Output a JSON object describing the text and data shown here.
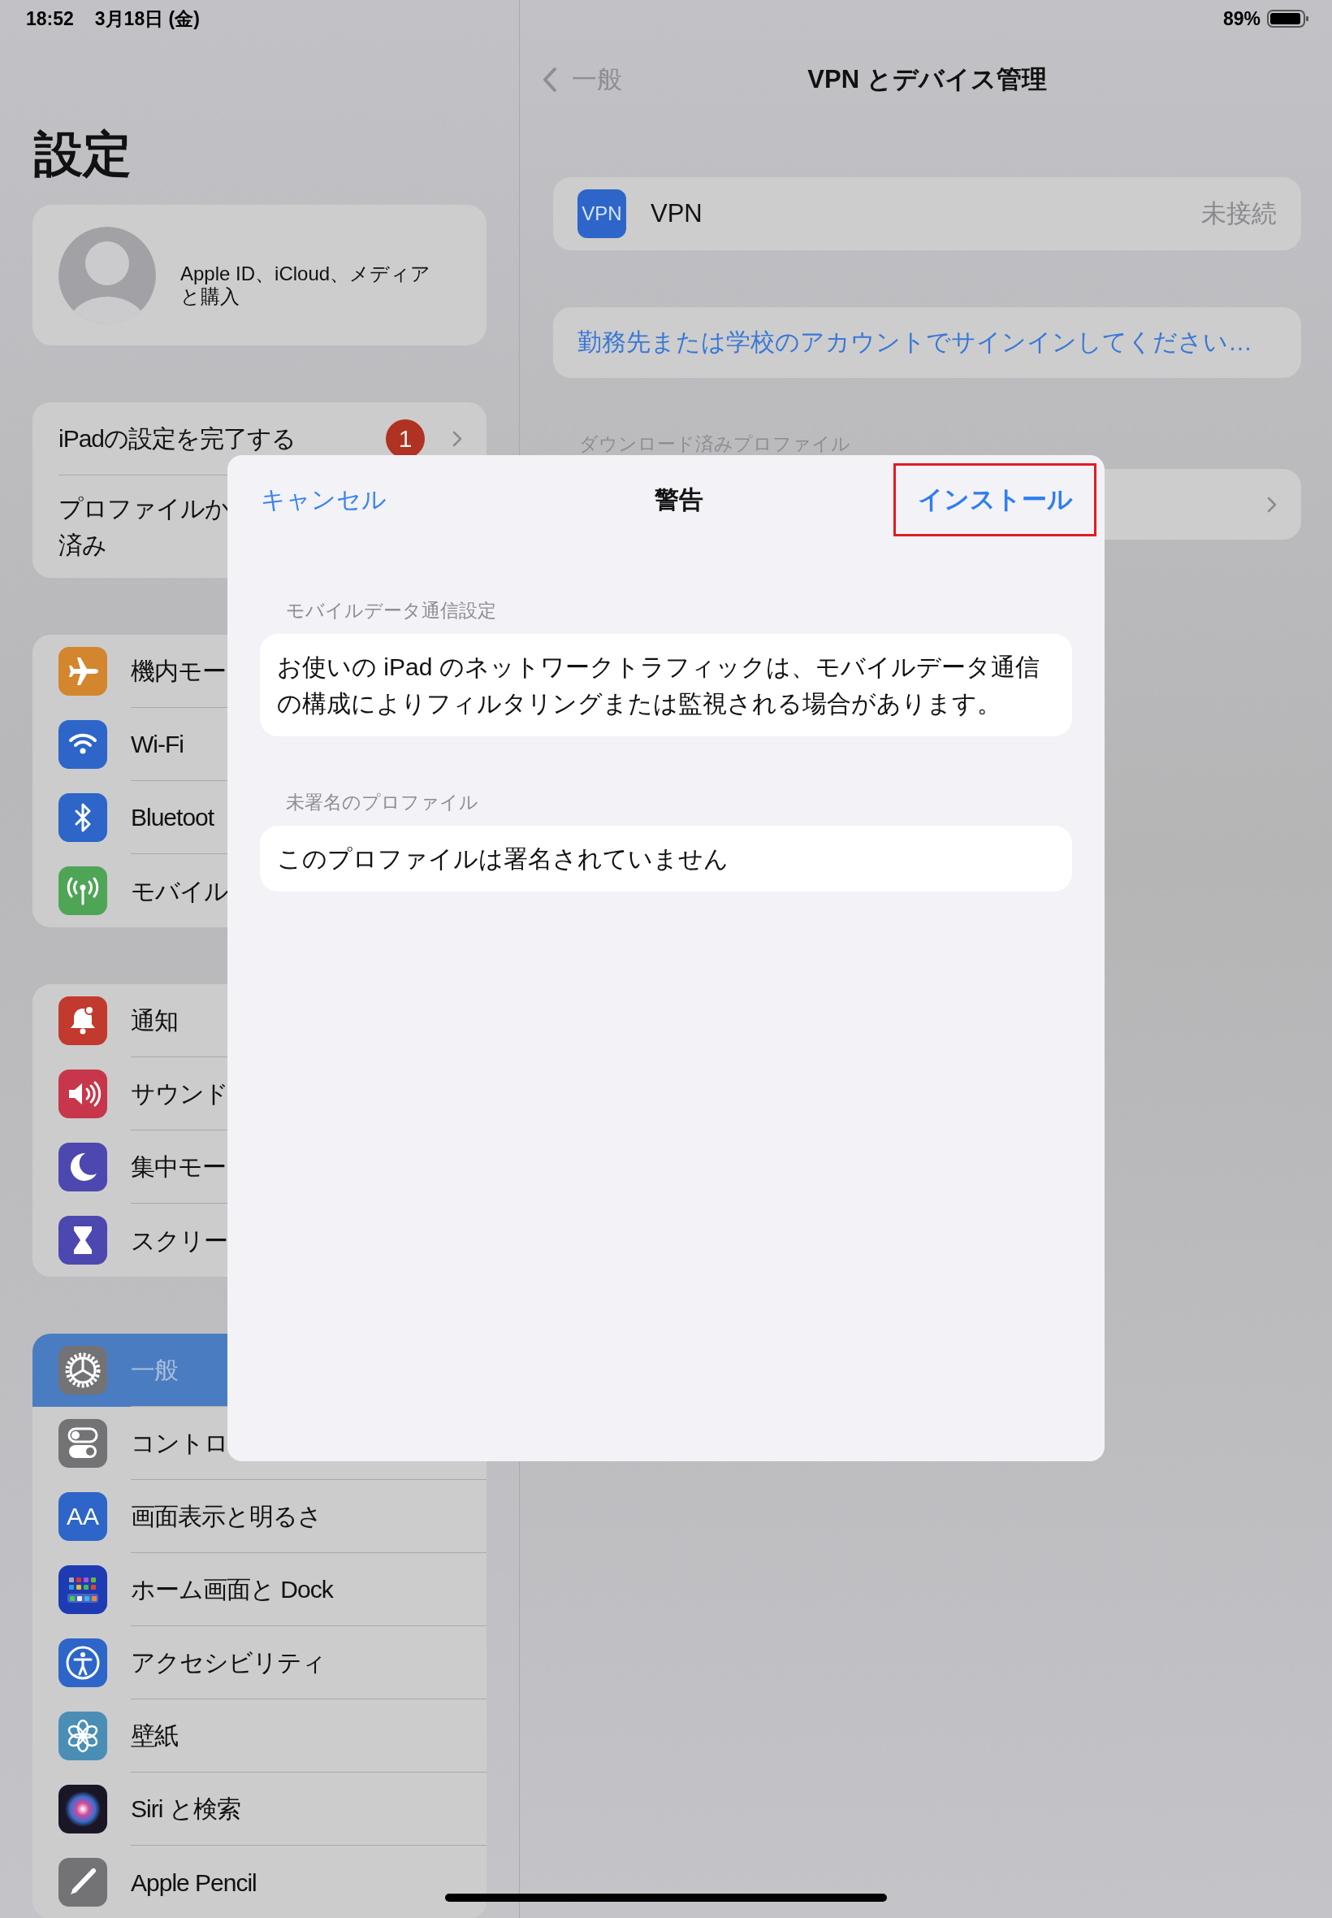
{
  "status_bar": {
    "time": "18:52",
    "date": "3月18日 (金)",
    "battery": "89%"
  },
  "sidebar": {
    "title": "設定",
    "account": {
      "text": "Apple ID、iCloud、メディアと購入"
    },
    "groups": [
      {
        "items": [
          {
            "lines": [
              "iPadの設定を完了する"
            ],
            "badge": "1",
            "chevron": true,
            "selected": false
          },
          {
            "lines": [
              "プロファイルか",
              "済み"
            ],
            "selected": false
          }
        ]
      },
      {
        "items": [
          {
            "lines": [
              "機内モー"
            ],
            "selected": false
          },
          {
            "lines": [
              "Wi-Fi"
            ],
            "selected": false
          },
          {
            "lines": [
              "Bluetoot"
            ],
            "selected": false
          },
          {
            "lines": [
              "モバイル"
            ],
            "selected": false
          }
        ]
      },
      {
        "items": [
          {
            "lines": [
              "通知"
            ],
            "selected": false
          },
          {
            "lines": [
              "サウンド"
            ],
            "selected": false
          },
          {
            "lines": [
              "集中モー"
            ],
            "selected": false
          },
          {
            "lines": [
              "スクリー"
            ],
            "selected": false
          }
        ]
      },
      {
        "items": [
          {
            "lines": [
              "一般"
            ],
            "selected": true
          },
          {
            "lines": [
              "コントロ"
            ],
            "selected": false
          },
          {
            "lines": [
              "画面表示と明るさ"
            ],
            "icon_text": "AA",
            "selected": false
          },
          {
            "lines": [
              "ホーム画面と Dock"
            ],
            "selected": false
          },
          {
            "lines": [
              "アクセシビリティ"
            ],
            "selected": false
          },
          {
            "lines": [
              "壁紙"
            ],
            "selected": false
          },
          {
            "lines": [
              "Siri と検索"
            ],
            "selected": false
          },
          {
            "lines": [
              "Apple Pencil"
            ],
            "selected": false
          }
        ]
      }
    ]
  },
  "detail": {
    "nav": {
      "back": "一般",
      "title": "VPN とデバイス管理"
    },
    "vpn": {
      "icon_text": "VPN",
      "label": "VPN",
      "status": "未接続"
    },
    "signin": "勤務先または学校のアカウントでサインインしてください…",
    "downloaded_header": "ダウンロード済みプロファイル",
    "profile_row": {
      "chevron": true
    }
  },
  "modal": {
    "cancel": "キャンセル",
    "title": "警告",
    "install": {
      "label": "インストール",
      "highlighted": true
    },
    "sections": [
      {
        "header": "モバイルデータ通信設定",
        "text": "お使いの iPad のネットワークトラフィックは、モバイルデータ通信の構成によりフィルタリングまたは監視される場合があります。"
      },
      {
        "header": "未署名のプロファイル",
        "text": "このプロファイルは署名されていません"
      }
    ]
  }
}
